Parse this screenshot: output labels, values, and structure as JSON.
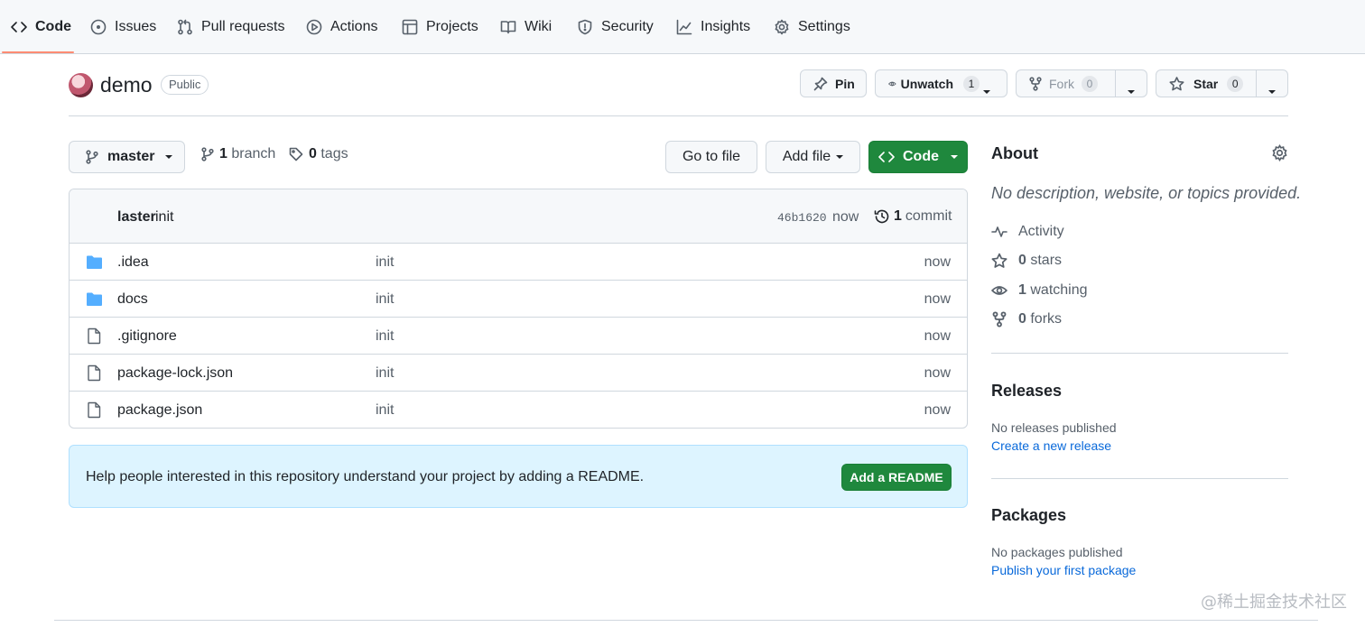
{
  "nav": {
    "tabs": [
      {
        "label": "Code",
        "icon": "code-icon",
        "active": true
      },
      {
        "label": "Issues",
        "icon": "issue-icon"
      },
      {
        "label": "Pull requests",
        "icon": "pull-request-icon"
      },
      {
        "label": "Actions",
        "icon": "play-icon"
      },
      {
        "label": "Projects",
        "icon": "table-icon"
      },
      {
        "label": "Wiki",
        "icon": "book-icon"
      },
      {
        "label": "Security",
        "icon": "shield-icon"
      },
      {
        "label": "Insights",
        "icon": "graph-icon"
      },
      {
        "label": "Settings",
        "icon": "gear-icon"
      }
    ]
  },
  "repo": {
    "name": "demo",
    "visibility": "Public",
    "pin_label": "Pin",
    "unwatch_label": "Unwatch",
    "watch_count": "1",
    "fork_label": "Fork",
    "fork_count": "0",
    "star_label": "Star",
    "star_count": "0"
  },
  "branch_bar": {
    "branch": "master",
    "branch_count": "1",
    "branch_word": "branch",
    "tag_count": "0",
    "tag_word": "tags",
    "go_to_file": "Go to file",
    "add_file": "Add file",
    "code": "Code"
  },
  "commit": {
    "author": "laster",
    "message": "init",
    "sha": "46b1620",
    "when": "now",
    "count": "1",
    "count_word": "commit"
  },
  "files": [
    {
      "name": ".idea",
      "type": "folder",
      "message": "init",
      "age": "now"
    },
    {
      "name": "docs",
      "type": "folder",
      "message": "init",
      "age": "now"
    },
    {
      "name": ".gitignore",
      "type": "file",
      "message": "init",
      "age": "now"
    },
    {
      "name": "package-lock.json",
      "type": "file",
      "message": "init",
      "age": "now"
    },
    {
      "name": "package.json",
      "type": "file",
      "message": "init",
      "age": "now"
    }
  ],
  "readme_banner": {
    "text": "Help people interested in this repository understand your project by adding a README.",
    "button": "Add a README"
  },
  "about": {
    "title": "About",
    "description": "No description, website, or topics provided.",
    "activity": "Activity",
    "stars_count": "0",
    "stars_word": "stars",
    "watching_count": "1",
    "watching_word": "watching",
    "forks_count": "0",
    "forks_word": "forks"
  },
  "releases": {
    "title": "Releases",
    "empty": "No releases published",
    "link": "Create a new release"
  },
  "packages": {
    "title": "Packages",
    "empty": "No packages published",
    "link": "Publish your first package"
  },
  "watermark": "@稀土掘金技术社区",
  "colors": {
    "accent_green": "#1f883d",
    "link_blue": "#0969da",
    "folder_blue": "#54aeff",
    "tab_underline": "#fd8c73"
  }
}
